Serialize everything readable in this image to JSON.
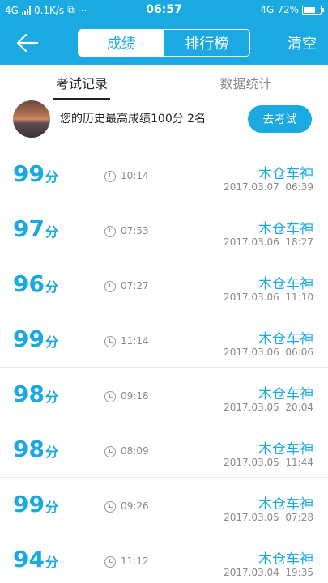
{
  "status_bar": {
    "network": "4G",
    "speed": "0.1K/s",
    "time": "06:57",
    "network_right": "4G",
    "battery": "72%",
    "battery_level": 0.72
  },
  "header": {
    "segments": [
      "成绩",
      "排行榜"
    ],
    "active_segment": 0,
    "clear_label": "清空"
  },
  "tabs": [
    "考试记录",
    "数据统计"
  ],
  "best": {
    "text": "您的历史最高成绩100分  2名",
    "button_label": "去考试"
  },
  "records": [
    {
      "score": "99",
      "unit": "分",
      "duration": "10:14",
      "name": "木仓车神",
      "date": "2017.03.07  06:39"
    },
    {
      "score": "97",
      "unit": "分",
      "duration": "07:53",
      "name": "木仓车神",
      "date": "2017.03.06  18:27"
    },
    {
      "score": "96",
      "unit": "分",
      "duration": "07:27",
      "name": "木仓车神",
      "date": "2017.03.06  11:10"
    },
    {
      "score": "99",
      "unit": "分",
      "duration": "11:14",
      "name": "木仓车神",
      "date": "2017.03.06  06:06"
    },
    {
      "score": "98",
      "unit": "分",
      "duration": "09:18",
      "name": "木仓车神",
      "date": "2017.03.05  20:04"
    },
    {
      "score": "98",
      "unit": "分",
      "duration": "08:09",
      "name": "木仓车神",
      "date": "2017.03.05  11:44"
    },
    {
      "score": "99",
      "unit": "分",
      "duration": "09:26",
      "name": "木仓车神",
      "date": "2017.03.05  07:28"
    },
    {
      "score": "94",
      "unit": "分",
      "duration": "11:12",
      "name": "木仓车神",
      "date": "2017.03.04  19:35"
    }
  ]
}
